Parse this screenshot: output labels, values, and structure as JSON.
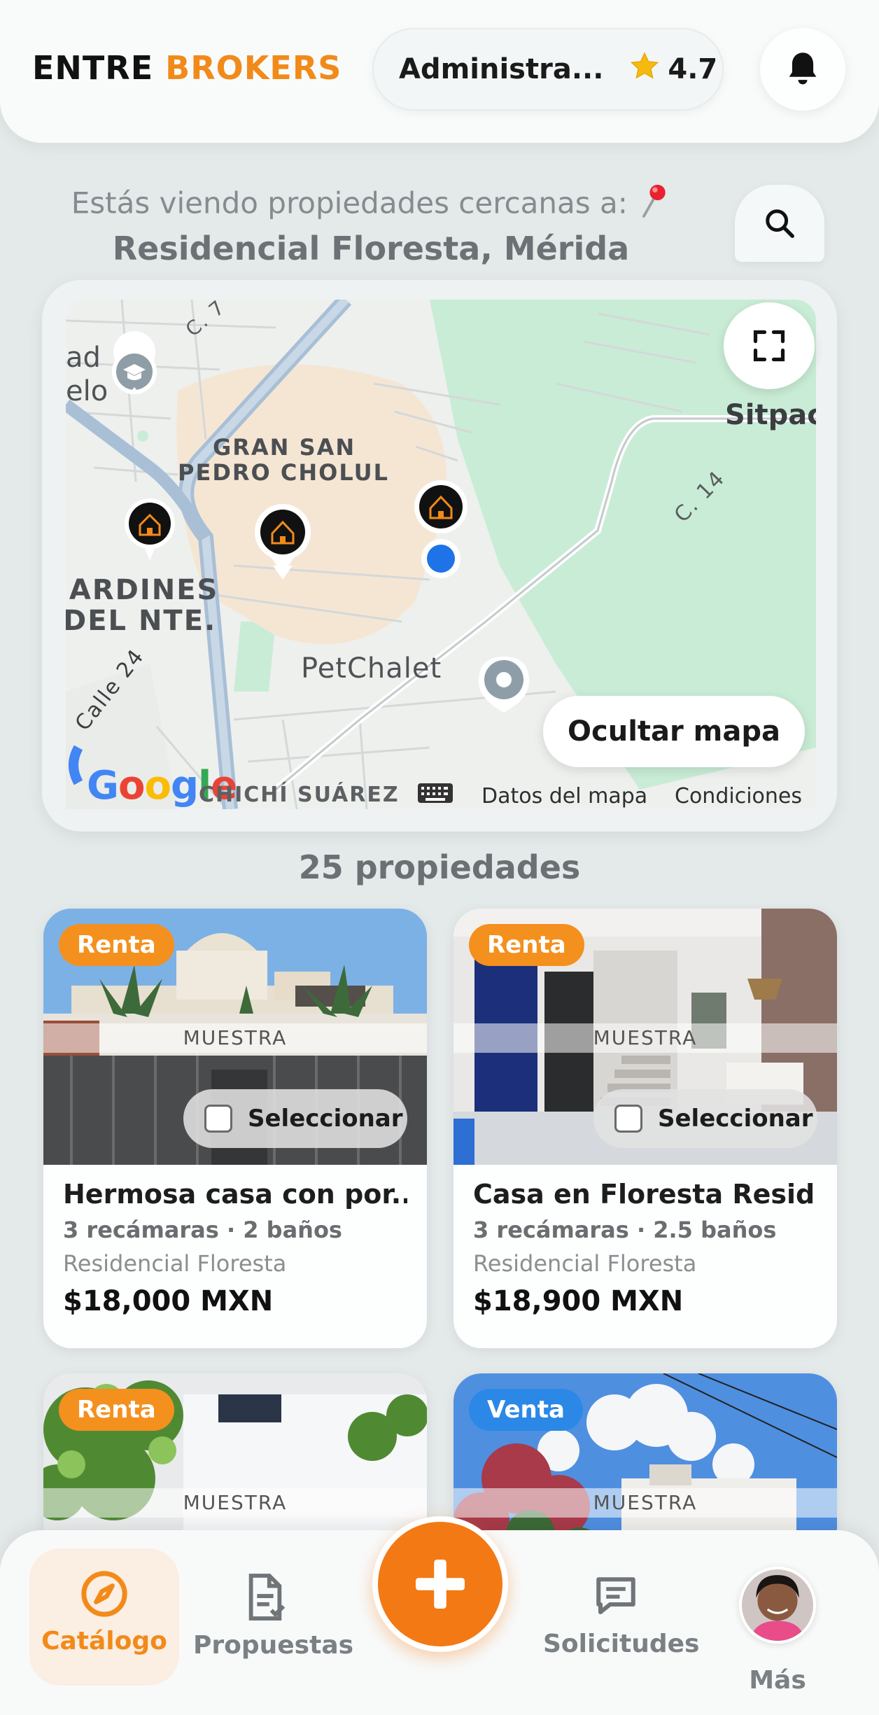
{
  "header": {
    "logo_part1": "ENTRE",
    "logo_part2": "BROKERS",
    "user_name": "Administra...",
    "rating": "4.7",
    "accent_color": "#f28a1a"
  },
  "location": {
    "prefix": "Estás viendo propiedades cercanas a:",
    "place": "Residencial Floresta, Mérida"
  },
  "map": {
    "labels": {
      "area_1": "GRAN SAN",
      "area_2": "PEDRO CHOLUL",
      "jardines_1": "JARDINES",
      "jardines_2": "DEL NTE.",
      "sitpac": "Sitpac",
      "petchalet": "PetChalet",
      "c7": "C. 7",
      "c14": "C. 14",
      "calle24": "Calle 24",
      "ad": "ad",
      "elo": "elo",
      "chichi": "CHICHÍ SUÁREZ"
    },
    "hide_label": "Ocultar mapa",
    "google": "Google",
    "datos": "Datos del mapa",
    "condiciones": "Condiciones"
  },
  "count_label": "25 propiedades",
  "properties": [
    {
      "badge": "Renta",
      "watermark": "MUESTRA",
      "select_label": "Seleccionar",
      "title": "Hermosa casa con por...",
      "specs": "3 recámaras · 2 baños",
      "area": "Residencial Floresta",
      "price": "$18,000 MXN"
    },
    {
      "badge": "Renta",
      "watermark": "MUESTRA",
      "select_label": "Seleccionar",
      "title": "Casa en Floresta Resid...",
      "specs": "3 recámaras · 2.5 baños",
      "area": "Residencial Floresta",
      "price": "$18,900 MXN"
    },
    {
      "badge": "Renta",
      "watermark": "MUESTRA"
    },
    {
      "badge": "Venta",
      "watermark": "MUESTRA"
    }
  ],
  "nav": {
    "catalogo": "Catálogo",
    "propuestas": "Propuestas",
    "solicitudes": "Solicitudes",
    "mas": "Más"
  }
}
